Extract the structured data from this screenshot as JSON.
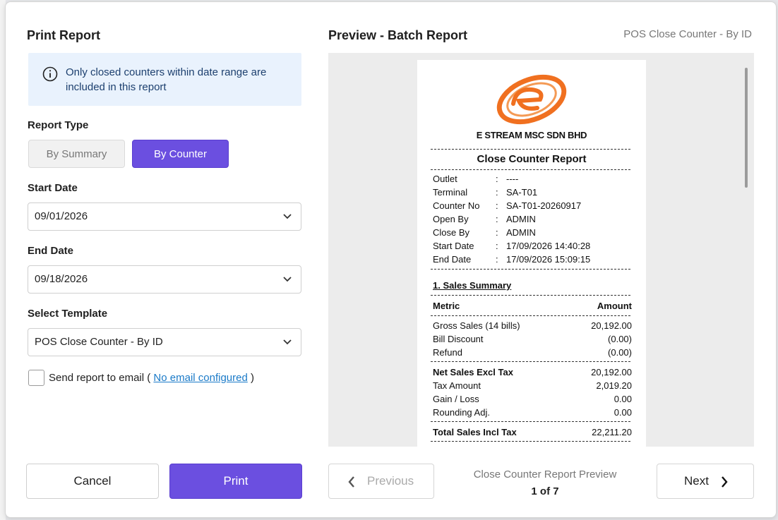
{
  "dialog": {
    "title": "Print Report",
    "info_text": "Only closed counters within date range are included in this report",
    "report_type": {
      "label": "Report Type",
      "options": [
        "By Summary",
        "By Counter"
      ],
      "selected": "By Counter"
    },
    "start_date": {
      "label": "Start Date",
      "value": "09/01/2026"
    },
    "end_date": {
      "label": "End Date",
      "value": "09/18/2026"
    },
    "template": {
      "label": "Select Template",
      "value": "POS Close Counter - By ID"
    },
    "email": {
      "checked": false,
      "label": "Send report to email",
      "paren_open": "(",
      "link": "No email configured",
      "paren_close": ")"
    },
    "buttons": {
      "cancel": "Cancel",
      "print": "Print"
    }
  },
  "preview": {
    "title": "Preview - Batch Report",
    "template_name": "POS Close Counter - By ID",
    "receipt": {
      "company": "E STREAM MSC SDN BHD",
      "report_title": "Close Counter Report",
      "fields": [
        {
          "key": "Outlet",
          "value": "----"
        },
        {
          "key": "Terminal",
          "value": "SA-T01"
        },
        {
          "key": "Counter No",
          "value": "SA-T01-20260917"
        },
        {
          "key": "Open By",
          "value": "ADMIN"
        },
        {
          "key": "Close By",
          "value": "ADMIN"
        },
        {
          "key": "Start Date",
          "value": "17/09/2026 14:40:28"
        },
        {
          "key": "End Date",
          "value": "17/09/2026 15:09:15"
        }
      ],
      "section_title": "1. Sales Summary",
      "table_header": {
        "metric": "Metric",
        "amount": "Amount"
      },
      "rows_a": [
        {
          "metric": "Gross Sales (14 bills)",
          "amount": "20,192.00"
        },
        {
          "metric": "Bill Discount",
          "amount": "(0.00)"
        },
        {
          "metric": "Refund",
          "amount": "(0.00)"
        }
      ],
      "net": {
        "metric": "Net Sales Excl Tax",
        "amount": "20,192.00"
      },
      "rows_b": [
        {
          "metric": "Tax Amount",
          "amount": "2,019.20"
        },
        {
          "metric": "Gain / Loss",
          "amount": "0.00"
        },
        {
          "metric": "Rounding Adj.",
          "amount": "0.00"
        }
      ],
      "total": {
        "metric": "Total Sales Incl Tax",
        "amount": "22,211.20"
      }
    },
    "pager": {
      "previous": "Previous",
      "next": "Next",
      "caption": "Close Counter Report Preview",
      "count": "1 of 7"
    }
  },
  "colors": {
    "accent": "#6b4fe0",
    "info_bg": "#e9f2fd",
    "link": "#1a7ac8",
    "logo_orange": "#f07020"
  },
  "icons": [
    "info-icon",
    "chevron-down-icon",
    "chevron-left-icon",
    "chevron-right-icon",
    "company-logo"
  ]
}
